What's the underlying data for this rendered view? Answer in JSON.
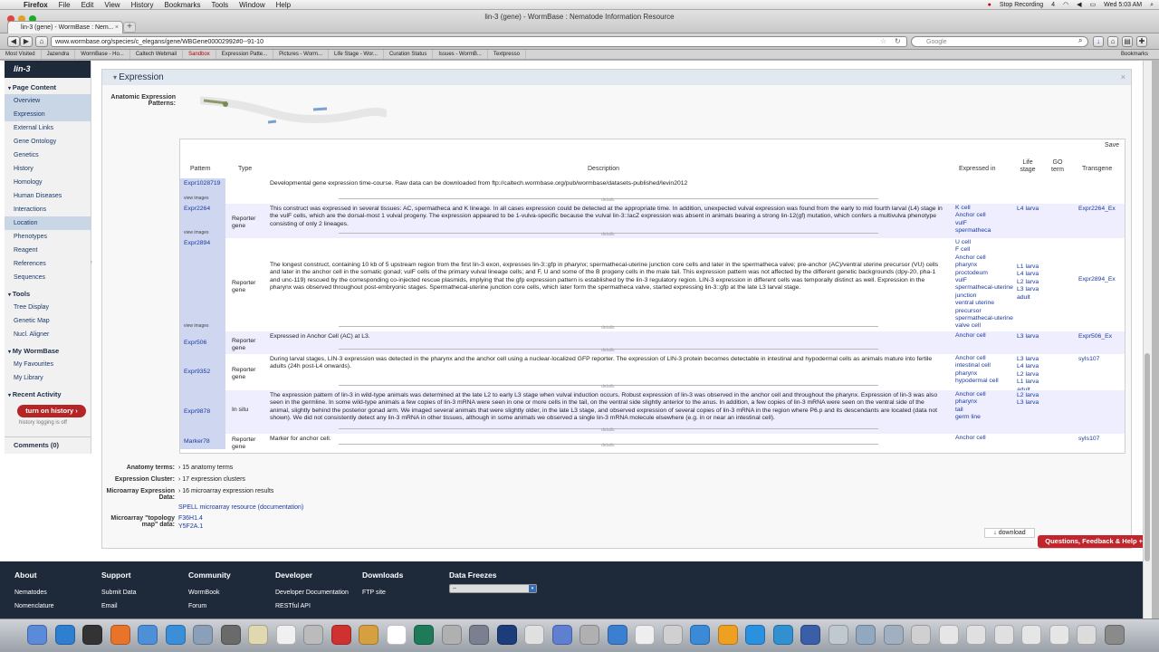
{
  "menubar": {
    "app": "Firefox",
    "items": [
      "File",
      "Edit",
      "View",
      "History",
      "Bookmarks",
      "Tools",
      "Window",
      "Help"
    ],
    "stop_recording": "Stop Recording",
    "clock": "Wed 5:03 AM",
    "battery": "4"
  },
  "window": {
    "title": "lin-3 (gene) - WormBase : Nematode Information Resource",
    "tab_label": "lin-3 (gene) - WormBase : Nem...",
    "url": "www.wormbase.org/species/c_elegans/gene/WBGene00002992#0--91-10",
    "search_placeholder": "Google"
  },
  "bookmarks": [
    "Most Visited",
    "Jazendra",
    "WormBase - Ho...",
    "Caltech Webmail",
    "Sandbox",
    "Expression Patte...",
    "Pictures - Worm...",
    "Life Stage - Wor...",
    "Curation Status",
    "Issues - WormB...",
    "Textpresso"
  ],
  "bookmarks_right": "Bookmarks",
  "sidebar": {
    "title": "lin-3",
    "page_content": "Page Content",
    "items": [
      "Overview",
      "Expression",
      "External Links",
      "Gene Ontology",
      "Genetics",
      "History",
      "Homology",
      "Human Diseases",
      "Interactions",
      "Location",
      "Phenotypes",
      "Reagent",
      "References",
      "Sequences"
    ],
    "tools": "Tools",
    "tool_items": [
      "Tree Display",
      "Genetic Map",
      "Nucl. Aligner"
    ],
    "my_wormbase": "My WormBase",
    "my_items": [
      "My Favourites",
      "My Library"
    ],
    "recent": "Recent Activity",
    "history_btn": "turn on history ›",
    "history_note": "history logging is off",
    "comments": "Comments (0)"
  },
  "expression": {
    "title": "Expression",
    "anatomic_label": "Anatomic Expression Patterns:",
    "save": "Save",
    "headers": [
      "Pattern",
      "Type",
      "Description",
      "Expressed in",
      "Life stage",
      "GO term",
      "Transgene"
    ],
    "rows": [
      {
        "pattern": "Expr1028719",
        "view": "view images",
        "type": "",
        "description": "Developmental gene expression time-course. Raw data can be downloaded from ftp://caltech.wormbase.org/pub/wormbase/datasets-published/levin2012",
        "expressed": [],
        "stage": [],
        "transgene": ""
      },
      {
        "pattern": "Expr2264",
        "view": "view images",
        "type": "Reporter gene",
        "description": "This construct was expressed in several tissues: AC, spermatheca and K lineage. In all cases expression could be detected at the appropriate time. In addition, unexpected vulval expression was found from the early to mid fourth larval (L4) stage in the vulF cells, which are the dorsal-most 1 vulval progeny. The expression appeared to be 1-vulva-specific because the vulval lin-3::lacZ expression was absent in animals bearing a strong lin-12(gf) mutation, which confers a multivulva phenotype consisting of only 2 lineages.",
        "expressed": [
          "K cell",
          "Anchor cell",
          "vulF",
          "spermatheca"
        ],
        "stage": [
          "L4 larva"
        ],
        "transgene": "Expr2264_Ex"
      },
      {
        "pattern": "Expr2894",
        "view": "view images",
        "type": "Reporter gene",
        "description": "The longest construct, containing 10 kb of 5 upstream region from the first lin-3 exon, expresses lin-3::gfp in pharynx; spermathecal-uterine junction core cells and later in the spermatheca valve; pre-anchor (AC)/ventral uterine precursor (VU) cells and later in the anchor cell in the somatic gonad; vulF cells of the primary vulval lineage cells; and F, U and some of the B progeny cells in the male tail. This expression pattern was not affected by the different genetic backgrounds (dpy-20, pha-1 and unc-119) rescued by the corresponding co-injected rescue plasmids, implying that the gfp expression pattern is established by the lin-3 regulatory region. LIN-3 expression in different cells was temporally distinct as well. Expression in the pharynx was observed throughout post-embryonic stages. Spermathecal-uterine junction core cells, which later form the spermatheca valve, started expressing lin-3::gfp at the late L3 larval stage.",
        "expressed": [
          "U cell",
          "F cell",
          "Anchor cell",
          "pharynx",
          "proctodeum",
          "vulF",
          "spermathecal-uterine junction",
          "ventral uterine precursor",
          "spermathecal-uterine valve cell"
        ],
        "stage": [
          "L1 larva",
          "L4 larva",
          "L2 larva",
          "L3 larva",
          "adult"
        ],
        "transgene": "Expr2894_Ex"
      },
      {
        "pattern": "Expr506",
        "view": "",
        "type": "Reporter gene",
        "description": "Expressed in Anchor Cell (AC) at L3.",
        "expressed": [
          "Anchor cell"
        ],
        "stage": [
          "L3 larva"
        ],
        "transgene": "Expr506_Ex"
      },
      {
        "pattern": "Expr9352",
        "view": "",
        "type": "Reporter gene",
        "description": "During larval stages, LIN-3 expression was detected in the pharynx and the anchor cell using a nuclear-localized GFP reporter. The expression of LIN-3 protein becomes detectable in intestinal and hypodermal cells as animals mature into fertile adults (24h post-L4 onwards).",
        "expressed": [
          "Anchor cell",
          "intestinal cell",
          "pharynx",
          "hypodermal cell"
        ],
        "stage": [
          "L3 larva",
          "L4 larva",
          "L2 larva",
          "L1 larva",
          "adult"
        ],
        "transgene": "syIs107"
      },
      {
        "pattern": "Expr9878",
        "view": "",
        "type": "In situ",
        "description": "The expression pattern of lin-3 in wild-type animals was determined at the late L2 to early L3 stage when vulval induction occurs. Robust expression of lin-3 was observed in the anchor cell and throughout the pharynx. Expression of lin-3 was also seen in the germline. In some wild-type animals a few copies of lin-3 mRNA were seen in one or more cells in the tail, on the ventral side slightly anterior to the anus. In addition, a few copies of lin-3 mRNA were seen on the ventral side of the animal, slightly behind the posterior gonad arm. We imaged several animals that were slightly older, in the late L3 stage, and observed expression of several copies of lin-3 mRNA in the region where P6.p and its descendants are located (data not shown). We did not consistently detect any lin-3 mRNA in other tissues, although in some animals we observed a single lin-3 mRNA molecule elsewhere (e.g. in or near an intestinal cell).",
        "expressed": [
          "Anchor cell",
          "pharynx",
          "tail",
          "germ line"
        ],
        "stage": [
          "L2 larva",
          "L3 larva"
        ],
        "transgene": ""
      },
      {
        "pattern": "Marker78",
        "view": "",
        "type": "Reporter gene",
        "description": "Marker for anchor cell.",
        "expressed": [
          "Anchor cell"
        ],
        "stage": [],
        "transgene": "syIs107"
      }
    ],
    "details": "details",
    "anatomy_label": "Anatomy terms:",
    "anatomy_value": "› 15 anatomy terms",
    "cluster_label": "Expression Cluster:",
    "cluster_value": "› 17 expression clusters",
    "microarray_label": "Microarray Expression Data:",
    "microarray_value": "› 16 microarray expression results",
    "spell": "SPELL microarray resource (documentation)",
    "topo_label": "Microarray \"topology map\" data:",
    "topo_values": [
      "F36H1.4",
      "Y5F2A.1"
    ],
    "download": "↓ download"
  },
  "footer": {
    "sections": [
      {
        "title": "About",
        "items": [
          "Nematodes",
          "Nomenclature"
        ]
      },
      {
        "title": "Support",
        "items": [
          "Submit Data",
          "Email"
        ]
      },
      {
        "title": "Community",
        "items": [
          "WormBook",
          "Forum"
        ]
      },
      {
        "title": "Developer",
        "items": [
          "Developer Documentation",
          "RESTful API"
        ]
      },
      {
        "title": "Downloads",
        "items": [
          "FTP site"
        ]
      },
      {
        "title": "Data Freezes",
        "items": []
      }
    ],
    "freeze_value": "--",
    "qfh": "Questions, Feedback & Help +"
  },
  "colors": {
    "nav_dark": "#1e2a3a",
    "accent_red": "#b52525",
    "link": "#1a3aa0"
  }
}
